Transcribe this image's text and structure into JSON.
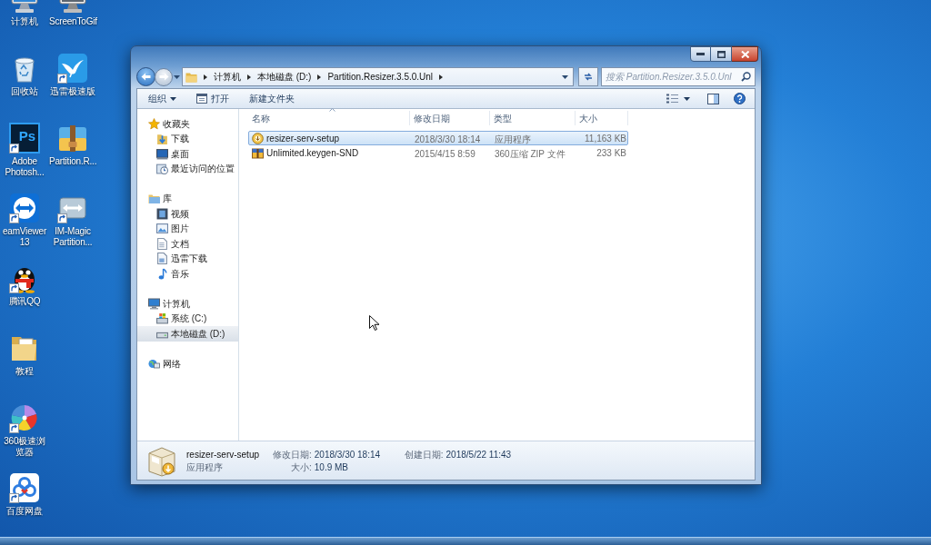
{
  "desktop": {
    "icons": [
      {
        "label": "计算机",
        "shortcut": false
      },
      {
        "label": "回收站",
        "shortcut": false
      },
      {
        "label": "Adobe Photosh...",
        "shortcut": true,
        "logo_text": "Ps"
      },
      {
        "label": "eamViewer 13",
        "shortcut": true
      },
      {
        "label": "腾讯QQ",
        "shortcut": true
      },
      {
        "label": "教程",
        "shortcut": false
      },
      {
        "label": "360极速浏览器",
        "shortcut": true
      },
      {
        "label": "百度网盘",
        "shortcut": true
      },
      {
        "label": "ScreenToGif",
        "shortcut": false
      },
      {
        "label": "迅雷极速版",
        "shortcut": true
      },
      {
        "label": "Partition.R...",
        "shortcut": false
      },
      {
        "label": "IM-Magic Partition...",
        "shortcut": true
      }
    ]
  },
  "window": {
    "address_bar": {
      "segments": [
        "计算机",
        "本地磁盘 (D:)",
        "Partition.Resizer.3.5.0.Unl"
      ]
    },
    "search": {
      "placeholder": "搜索 Partition.Resizer.3.5.0.Unl"
    },
    "toolbar": {
      "buttons": [
        {
          "label": "组织",
          "kind": "menu"
        },
        {
          "label": "打开",
          "kind": "open"
        },
        {
          "label": "新建文件夹",
          "kind": "plain"
        }
      ]
    },
    "sidebar": {
      "items": [
        {
          "label": "收藏夹",
          "selected": false,
          "children": [
            {
              "label": "下载",
              "selected": false
            },
            {
              "label": "桌面",
              "selected": false
            },
            {
              "label": "最近访问的位置",
              "selected": false
            }
          ]
        },
        {
          "label": "库",
          "selected": false,
          "children": [
            {
              "label": "视频",
              "selected": false
            },
            {
              "label": "图片",
              "selected": false
            },
            {
              "label": "文档",
              "selected": false
            },
            {
              "label": "迅雷下载",
              "selected": false
            },
            {
              "label": "音乐",
              "selected": false
            }
          ]
        },
        {
          "label": "计算机",
          "selected": false,
          "children": [
            {
              "label": "系统 (C:)",
              "selected": false
            },
            {
              "label": "本地磁盘 (D:)",
              "selected": true
            }
          ]
        },
        {
          "label": "网络",
          "selected": false
        }
      ]
    },
    "file_list": {
      "columns": [
        {
          "label": "名称",
          "sorted": true
        },
        {
          "label": "修改日期",
          "sorted": false
        },
        {
          "label": "类型",
          "sorted": false
        },
        {
          "label": "大小",
          "sorted": false
        }
      ],
      "rows": [
        {
          "name": "resizer-serv-setup",
          "modified": "2018/3/30 18:14",
          "type": "应用程序",
          "size": "11,163 KB",
          "kind": "exe",
          "selected": true
        },
        {
          "name": "Unlimited.keygen-SND",
          "modified": "2015/4/15 8:59",
          "type": "360压缩 ZIP 文件",
          "size": "233 KB",
          "kind": "zip",
          "selected": false
        }
      ]
    },
    "details_pane": {
      "name": "resizer-serv-setup",
      "type": "应用程序",
      "fields": [
        {
          "label": "修改日期:",
          "value": "2018/3/30 18:14"
        },
        {
          "label": "大小:",
          "value": "10.9 MB"
        },
        {
          "label": "创建日期:",
          "value": "2018/5/22 11:43"
        }
      ]
    }
  }
}
